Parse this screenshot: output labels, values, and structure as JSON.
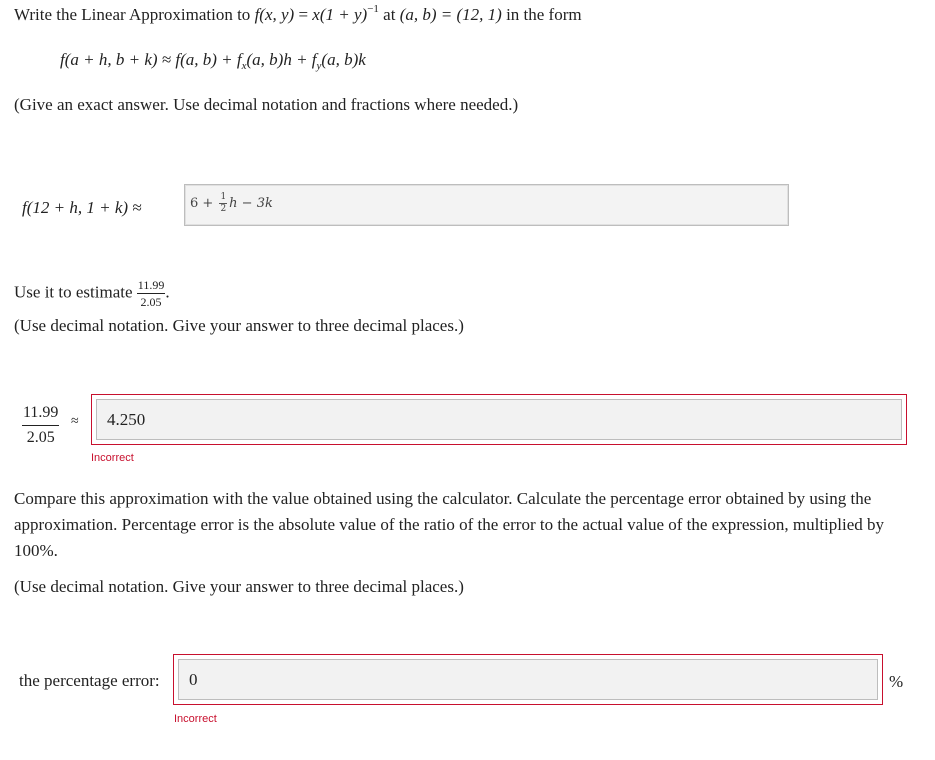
{
  "question": {
    "intro_text": "Write the Linear Approximation to",
    "func_lhs": "f(x, y)",
    "func_rhs": "x(1 + y)",
    "func_exp": "−1",
    "at_text": "at",
    "point": "(a, b) = (12, 1)",
    "in_form": "in the form",
    "form_formula": "f(a + h, b + k) ≈ f(a, b) + f",
    "form_fx_sub": "x",
    "form_middle": "(a, b)h + f",
    "form_fy_sub": "y",
    "form_end": "(a, b)k",
    "instruction1": "(Give an exact answer. Use decimal notation and fractions where needed.)"
  },
  "part1": {
    "lhs_label": "f(12 + h, 1 + k) ≈",
    "answer_prefix": "6 + ",
    "answer_frac_num": "1",
    "answer_frac_den": "2",
    "answer_suffix": "h − 3k"
  },
  "part2": {
    "prompt_text": "Use it to estimate",
    "frac_num": "11.99",
    "frac_den": "2.05",
    "prompt_end": ".",
    "instruction": "(Use decimal notation. Give your answer to three decimal places.)",
    "lhs_num": "11.99",
    "lhs_den": "2.05",
    "approx_symbol": "≈",
    "answer_value": "4.250",
    "feedback": "Incorrect"
  },
  "part3": {
    "paragraph": "Compare this approximation with the value obtained using the calculator. Calculate the percentage error obtained by using the approximation. Percentage error is the absolute value of the ratio of the error to the actual value of the expression, multiplied by 100%.",
    "instruction": "(Use decimal notation. Give your answer to three decimal places.)",
    "label": "the percentage error:",
    "answer_value": "0",
    "unit": "%",
    "feedback": "Incorrect"
  },
  "colors": {
    "error_red": "#c8102e",
    "input_bg": "#f2f2f2"
  }
}
